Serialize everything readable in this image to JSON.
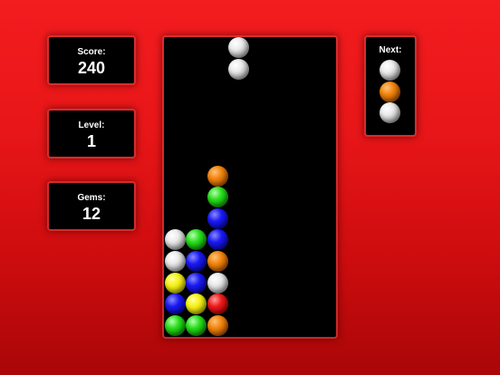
{
  "hud": {
    "score": {
      "label": "Score:",
      "value": "240"
    },
    "level": {
      "label": "Level:",
      "value": "1"
    },
    "gems": {
      "label": "Gems:",
      "value": "12"
    }
  },
  "next": {
    "label": "Next:",
    "pieces": [
      "white",
      "orange",
      "white"
    ]
  },
  "board": {
    "columns": 8,
    "rows": 14,
    "falling": {
      "column": 3,
      "gems": [
        "white",
        "white"
      ]
    },
    "stack": {
      "col0": [
        "green",
        "blue",
        "yellow",
        "white",
        "white"
      ],
      "col1": [
        "green",
        "yellow",
        "blue",
        "blue",
        "green"
      ],
      "col2": [
        "orange",
        "red",
        "white",
        "orange",
        "blue",
        "blue",
        "green",
        "orange"
      ]
    }
  },
  "colors": {
    "background_top": "#f31c1f",
    "background_bottom": "#a90608",
    "panel": "#000000",
    "text": "#ffffff"
  }
}
